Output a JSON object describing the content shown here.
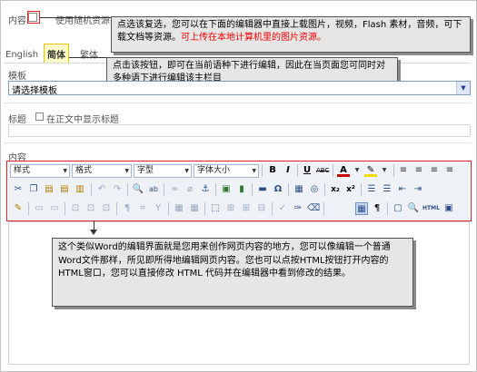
{
  "header": {
    "content_label": "内容",
    "random_resource_label": "使用随机资源"
  },
  "tabs": [
    {
      "label": "English"
    },
    {
      "label": "简体"
    },
    {
      "label": "繁体"
    }
  ],
  "template": {
    "label": "模板",
    "select_value": "请选择模板"
  },
  "title_field": {
    "label": "标题",
    "show_title_label": "在正文中显示标题"
  },
  "content": {
    "label": "内容"
  },
  "toolbar": {
    "style_select": "样式",
    "format_select": "格式",
    "font_select": "字型",
    "size_select": "字体大小"
  },
  "callouts": {
    "top_text": "点选该复选，您可以在下面的编辑器中直接上载图片，视频，Flash 素材，音频，可下载文档等资源。",
    "top_red_text": "可上传在本地计算机里的图片资源。",
    "tab_text": "点击该按钮，即可在当前语种下进行编辑，因此在当页面您可同时对多种语下进行编辑该主栏目",
    "bottom_text": "这个类似Word的编辑界面就是您用来创作网页内容的地方，您可以像编辑一个普通Word文件那样，所见即所得地编辑网页内容。您也可以点按HTML按钮打开内容的HTML窗口，您可以直接修改 HTML 代码并在编辑器中看到修改的结果。"
  },
  "colors": {
    "callout_border": "#555555",
    "highlight_red": "#e02020",
    "toolbar_bg": "#eef1f6"
  }
}
